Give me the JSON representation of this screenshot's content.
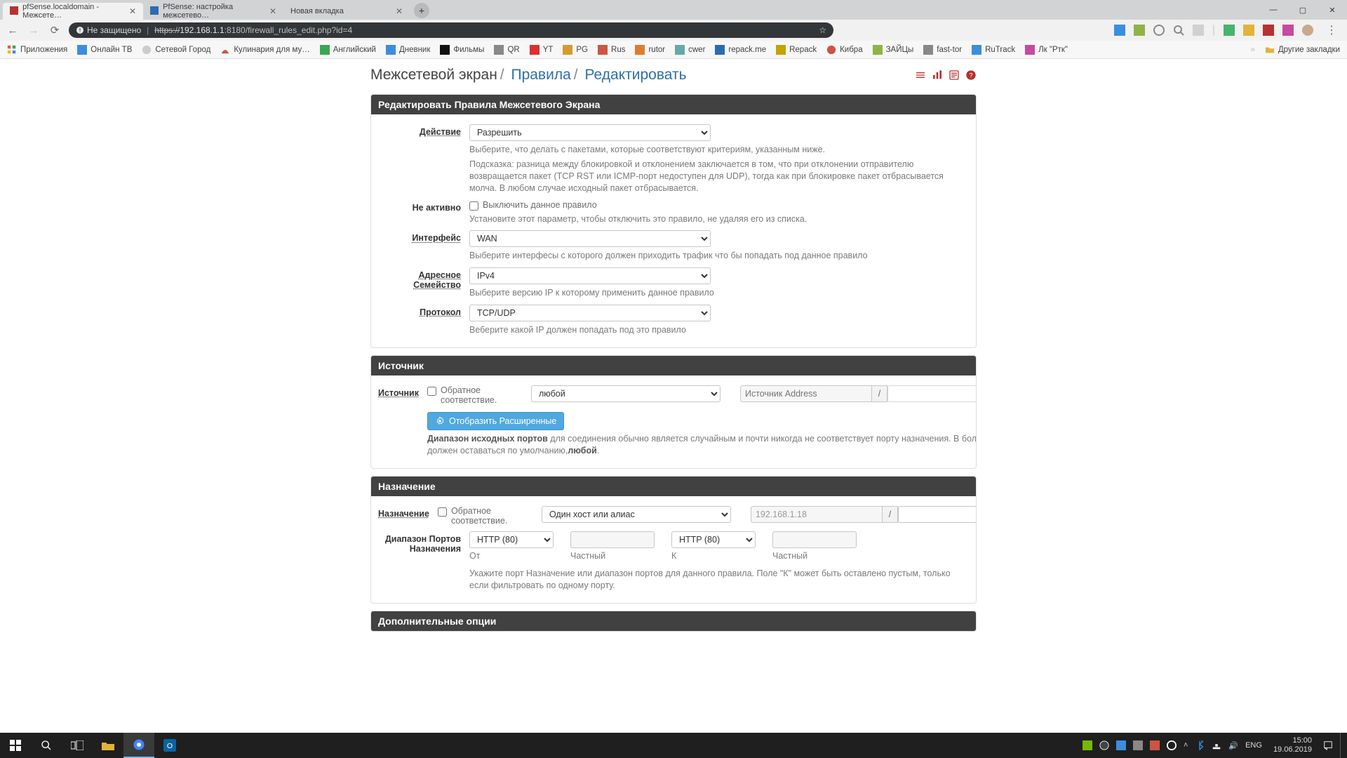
{
  "browser": {
    "tabs": [
      {
        "title": "pfSense.localdomain - Межсете…",
        "active": true
      },
      {
        "title": "PfSense: настройка межсетево…",
        "active": false
      },
      {
        "title": "Новая вкладка",
        "active": false
      }
    ],
    "security_label": "Не защищено",
    "url_prefix": "https://",
    "url_host": "192.168.1.1",
    "url_path": ":8180/firewall_rules_edit.php?id=4"
  },
  "bookmarks": {
    "apps": "Приложения",
    "items": [
      "Онлайн ТВ",
      "Сетевой Город",
      "Кулинария для му…",
      "Английский",
      "Дневник",
      "Фильмы",
      "QR",
      "YT",
      "PG",
      "Rus",
      "rutor",
      "cwer",
      "repack.me",
      "Repack",
      "Кибра",
      "ЗАЙЦы",
      "fast-tor",
      "RuTrack",
      "Лк \"Ртк\""
    ],
    "other": "Другие закладки"
  },
  "breadcrumbs": {
    "a": "Межсетевой экран",
    "b": "Правила",
    "c": "Редактировать"
  },
  "panels": {
    "edit": "Редактировать Правила Межсетевого Экрана",
    "source": "Источник",
    "dest": "Назначение",
    "extra": "Дополнительные опции"
  },
  "labels": {
    "action": "Действие",
    "disabled": "Не активно",
    "interface": "Интерфейс",
    "addrfam": "Адресное Семейство",
    "protocol": "Протокол",
    "source": "Источник",
    "dest": "Назначение",
    "dport": "Диапазон Портов Назначения"
  },
  "fields": {
    "action_value": "Разрешить",
    "action_help": "Выберите, что делать с пакетами, которые соответствуют критериям, указанным ниже.",
    "action_hint": "Подсказка: разница между блокировкой и отклонением заключается в том, что при отклонении отправителю возвращается пакет (TCP RST или ICMP-порт недоступен для UDP), тогда как при блокировке пакет отбрасывается молча. В любом случае исходный пакет отбрасывается.",
    "disabled_chk": "Выключить данное правило",
    "disabled_help": "Установите этот параметр, чтобы отключить это правило, не удаляя его из списка.",
    "iface_value": "WAN",
    "iface_help": "Выберите интерфесы с которого должен приходить трафик что бы попадать под данное правило",
    "addrfam_value": "IPv4",
    "addrfam_help": "Выберите версию IP к которому применить данное правило",
    "proto_value": "TCP/UDP",
    "proto_help": "Веберите какой IP должен попадать под это правило",
    "invert_label": "Обратное соответствие.",
    "src_type": "любой",
    "src_addr_ph": "Источник Address",
    "slash": "/",
    "adv_btn": "Отобразить Расширенные",
    "src_help_bold": "Диапазон исходных портов",
    "src_help_rest": " для соединения обычно является случайным и почти никогда не соответствует порту назначения. В большинстве случаев этот параметр должен оставаться по умолчанию,",
    "src_help_bold2": "любой",
    "dst_type": "Один хост или алиас",
    "dst_addr": "192.168.1.18",
    "port_from_sel": "HTTP (80)",
    "port_to_sel": "HTTP (80)",
    "port_from_lbl": "От",
    "port_custom_lbl": "Частный",
    "port_to_lbl": "К",
    "dport_help": "Укажите порт Назначение или диапазон портов для данного правила. Поле \"К\" может быть оставлено пустым, только если фильтровать по одному порту."
  },
  "taskbar": {
    "lang": "ENG",
    "time": "15:00",
    "date": "19.06.2019"
  }
}
